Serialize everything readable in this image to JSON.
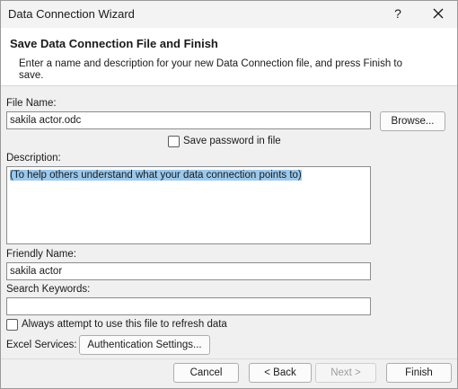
{
  "window": {
    "title": "Data Connection Wizard",
    "help_glyph": "?"
  },
  "header": {
    "title": "Save Data Connection File and Finish",
    "subtitle": "Enter a name and description for your new Data Connection file, and press Finish to save."
  },
  "file_name": {
    "label": "File Name:",
    "value": "sakila actor.odc",
    "browse_label": "Browse..."
  },
  "save_password": {
    "label": "Save password in file",
    "checked": false
  },
  "description": {
    "label": "Description:",
    "value": "(To help others understand what your data connection points to)"
  },
  "friendly_name": {
    "label": "Friendly Name:",
    "value": "sakila actor"
  },
  "search_keywords": {
    "label": "Search Keywords:",
    "value": ""
  },
  "always_refresh": {
    "label": "Always attempt to use this file to refresh data",
    "checked": false
  },
  "excel_services": {
    "label": "Excel Services:",
    "auth_button_label": "Authentication Settings..."
  },
  "footer": {
    "cancel_label": "Cancel",
    "back_label": "< Back",
    "next_label": "Next >",
    "finish_label": "Finish"
  }
}
